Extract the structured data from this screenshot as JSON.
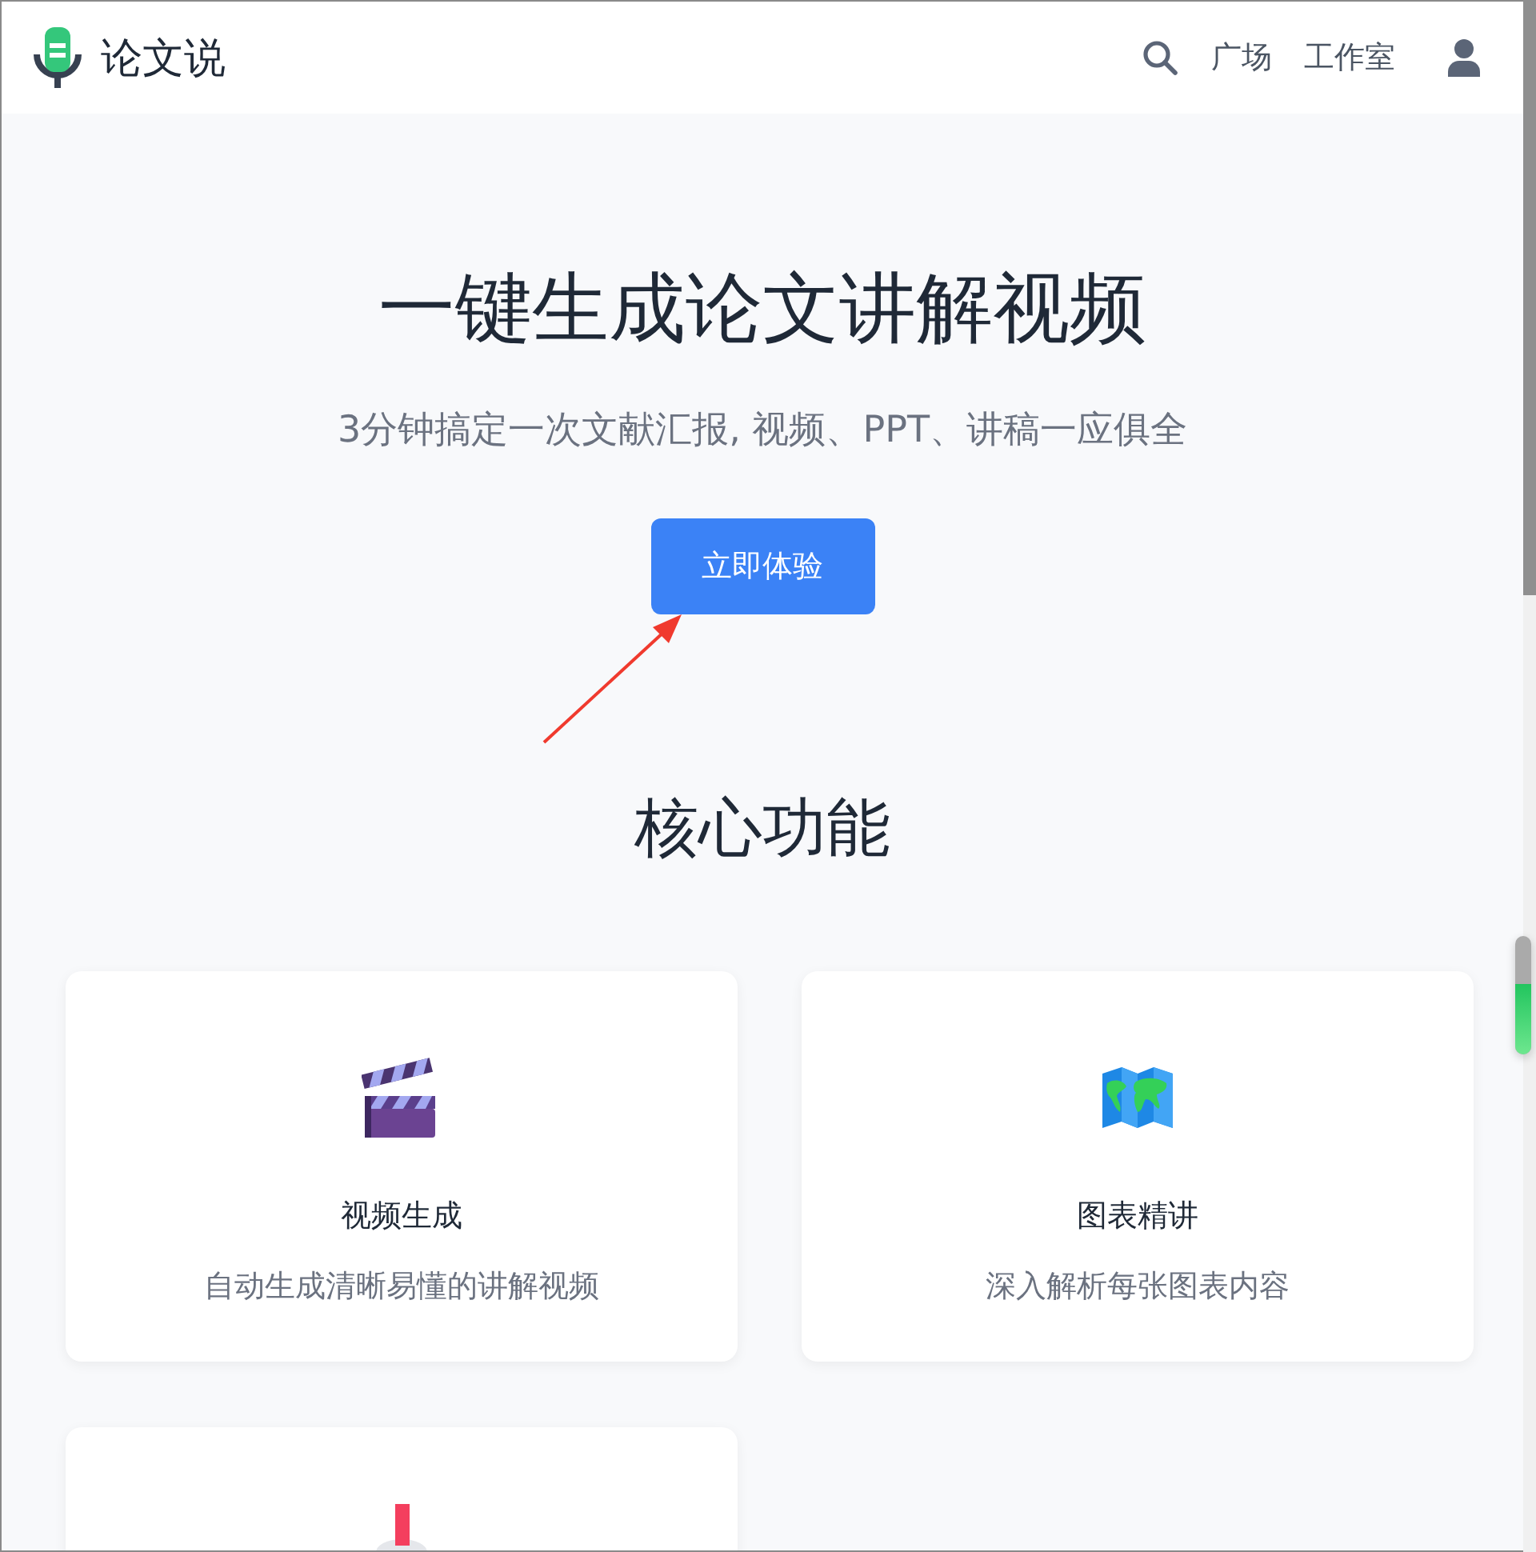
{
  "header": {
    "brand": "论文说",
    "nav": [
      "广场",
      "工作室"
    ]
  },
  "hero": {
    "title": "一键生成论文讲解视频",
    "subtitle": "3分钟搞定一次文献汇报, 视频、PPT、讲稿一应俱全",
    "button": "立即体验"
  },
  "features": {
    "heading": "核心功能",
    "cards": [
      {
        "kind": "full",
        "title": "视频生成",
        "description": "自动生成清晰易懂的讲解视频"
      },
      {
        "kind": "full",
        "title": "图表精讲",
        "description": "深入解析每张图表内容"
      },
      {
        "kind": "partial"
      }
    ]
  },
  "meter": {
    "level": 0.6
  }
}
